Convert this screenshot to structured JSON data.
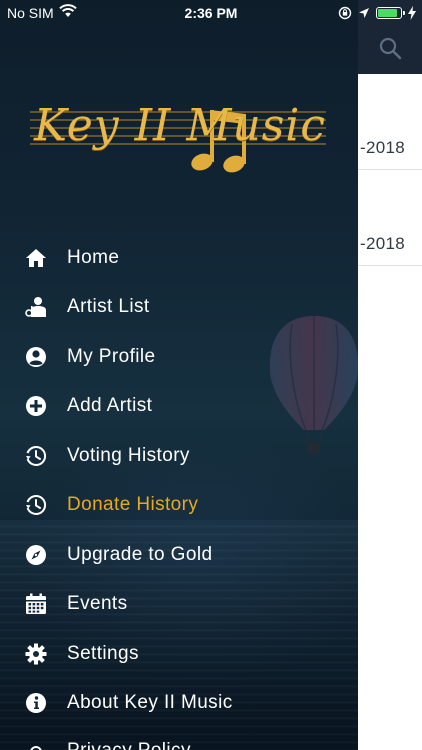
{
  "status_bar": {
    "carrier": "No SIM",
    "time": "2:36 PM"
  },
  "background": {
    "rows": [
      {
        "date_fragment": "-2018"
      },
      {
        "date_fragment": "-2018"
      }
    ],
    "accent_color": "#f2b01e"
  },
  "drawer": {
    "logo_text": "Key II Music",
    "menu": [
      {
        "label": "Home",
        "icon": "home-icon",
        "active": false
      },
      {
        "label": "Artist List",
        "icon": "artist-list-icon",
        "active": false
      },
      {
        "label": "My Profile",
        "icon": "profile-icon",
        "active": false
      },
      {
        "label": "Add Artist",
        "icon": "add-circle-icon",
        "active": false
      },
      {
        "label": "Voting History",
        "icon": "history-icon",
        "active": false
      },
      {
        "label": "Donate History",
        "icon": "history-icon",
        "active": true
      },
      {
        "label": "Upgrade to Gold",
        "icon": "compass-icon",
        "active": false
      },
      {
        "label": "Events",
        "icon": "calendar-icon",
        "active": false
      },
      {
        "label": "Settings",
        "icon": "gear-icon",
        "active": false
      },
      {
        "label": "About Key II Music",
        "icon": "info-icon",
        "active": false
      },
      {
        "label": "Privacy Policy",
        "icon": "lock-icon",
        "active": false
      }
    ],
    "active_color": "#e7a824",
    "text_color": "#ffffff"
  }
}
